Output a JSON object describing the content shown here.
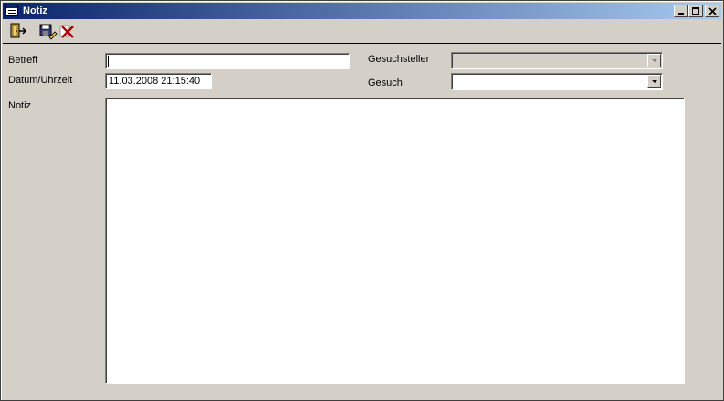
{
  "window": {
    "title": "Notiz",
    "icon": "form-icon",
    "controls": [
      "minimize-icon",
      "maximize-icon",
      "close-icon"
    ]
  },
  "toolbar": {
    "buttons": [
      {
        "name": "exit-button",
        "icon": "door-exit-icon"
      },
      {
        "name": "save-button",
        "icon": "save-edit-icon"
      },
      {
        "name": "delete-button",
        "icon": "delete-x-icon"
      }
    ]
  },
  "form": {
    "betreff": {
      "label": "Betreff",
      "value": ""
    },
    "datum": {
      "label": "Datum/Uhrzeit",
      "value": "11.03.2008 21:15:40"
    },
    "gesuchsteller": {
      "label": "Gesuchsteller",
      "value": "",
      "disabled": true
    },
    "gesuch": {
      "label": "Gesuch",
      "value": ""
    },
    "notiz": {
      "label": "Notiz",
      "value": ""
    }
  },
  "colors": {
    "title_start": "#0a246a",
    "title_end": "#a6caf0",
    "face": "#d4d0c8"
  }
}
